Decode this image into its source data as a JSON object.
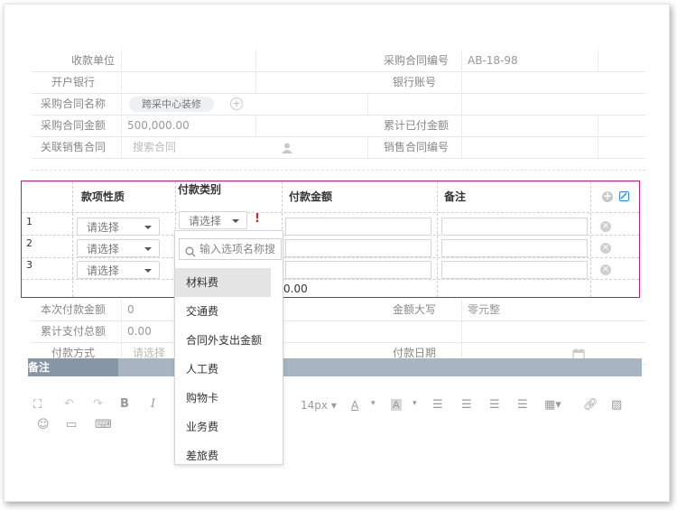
{
  "form": {
    "rows": [
      {
        "label": "收款单位",
        "value": "",
        "label2": "采购合同编号",
        "value2": "AB-18-98"
      },
      {
        "label": "开户银行",
        "value": "",
        "label2": "银行账号",
        "value2": ""
      },
      {
        "label": "采购合同名称",
        "tag": "跨采中心装修",
        "label2": "",
        "value2": ""
      },
      {
        "label": "采购合同金额",
        "value": "500,000.00",
        "label2": "累计已付金额",
        "value2": ""
      },
      {
        "label": "关联销售合同",
        "placeholder": "搜索合同",
        "label2": "销售合同编号",
        "value2": ""
      }
    ]
  },
  "table": {
    "headers": [
      "款项性质",
      "付款类别",
      "付款金额",
      "备注"
    ],
    "rows": [
      {
        "num": "1",
        "nature": "请选择",
        "category": "请选择",
        "required_mark": "!"
      },
      {
        "num": "2",
        "nature": "请选择"
      },
      {
        "num": "3",
        "nature": "请选择"
      }
    ],
    "total_partial": "0.00"
  },
  "dropdown": {
    "search_placeholder": "输入选项名称搜",
    "options": [
      "材料费",
      "交通费",
      "合同外支出金额",
      "人工费",
      "购物卡",
      "业务费",
      "差旅费"
    ],
    "active_index": 0
  },
  "summary": {
    "rows": [
      {
        "label": "本次付款金额",
        "value": "0",
        "label2": "金额大写",
        "value2": "零元整"
      },
      {
        "label": "累计支付总额",
        "value": "0.00",
        "label2": "",
        "value2": ""
      },
      {
        "label": "付款方式",
        "value": "请选择",
        "label2": "付款日期",
        "value2": ""
      }
    ]
  },
  "remarks": {
    "label": "备注"
  },
  "editor": {
    "font_size": "14px",
    "font_color_label": "A",
    "bg_color_label": "A",
    "bold": "B",
    "italic": "I"
  },
  "colors": {
    "accent_border": "#b0237a",
    "section_bar": "#a7b4c2",
    "required": "#e02020",
    "icon_blue": "#2a8ad4"
  }
}
